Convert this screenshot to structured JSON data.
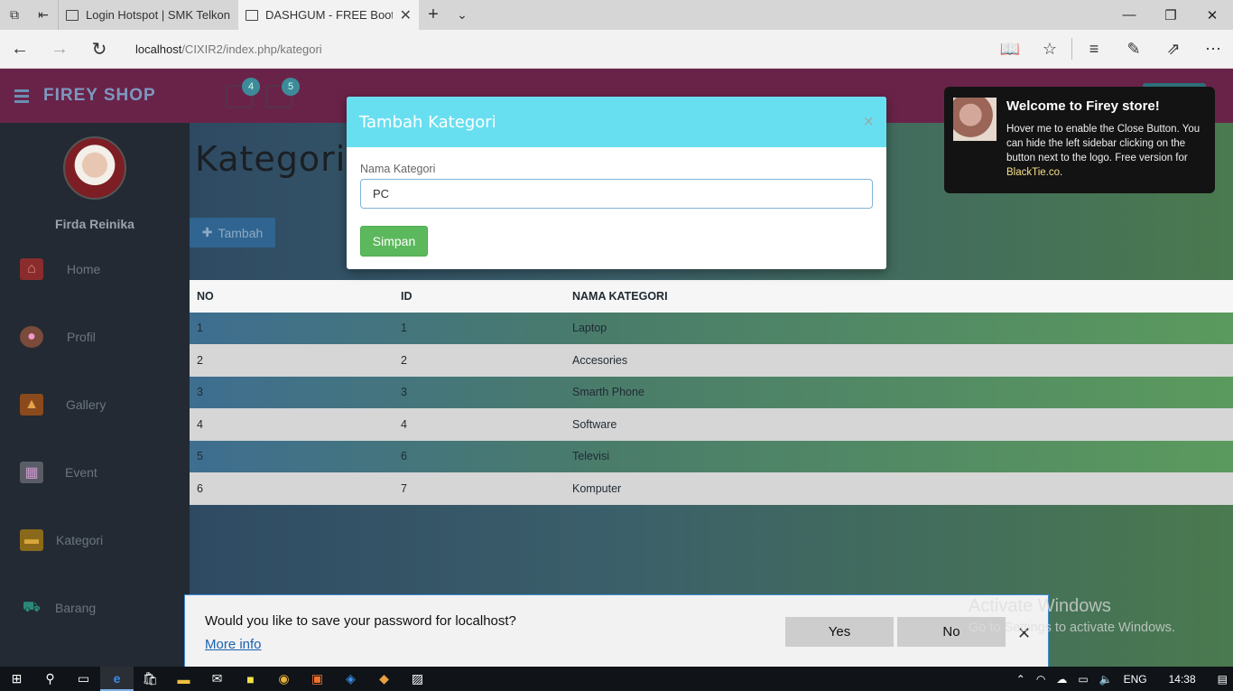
{
  "browser": {
    "tabs": [
      {
        "title": "Login Hotspot | SMK Telkon",
        "active": false
      },
      {
        "title": "DASHGUM - FREE Boots",
        "active": true
      }
    ],
    "url_host": "localhost",
    "url_path": "/CIXIR2/index.php/kategori"
  },
  "header": {
    "logo": "FIREY SHOP",
    "badges": [
      "4",
      "5"
    ]
  },
  "sidebar": {
    "username": "Firda Reinika",
    "items": [
      {
        "label": "Home",
        "icon": "home-icon"
      },
      {
        "label": "Profil",
        "icon": "user-icon"
      },
      {
        "label": "Gallery",
        "icon": "image-icon"
      },
      {
        "label": "Event",
        "icon": "calendar-icon"
      },
      {
        "label": "Kategori",
        "icon": "folder-icon"
      },
      {
        "label": "Barang",
        "icon": "cart-icon"
      }
    ]
  },
  "main": {
    "title": "Kategori",
    "add_button": "Tambah",
    "table": {
      "headers": [
        "NO",
        "ID",
        "NAMA KATEGORI"
      ],
      "rows": [
        [
          "1",
          "1",
          "Laptop"
        ],
        [
          "2",
          "2",
          "Accesories"
        ],
        [
          "3",
          "3",
          "Smarth Phone"
        ],
        [
          "4",
          "4",
          "Software"
        ],
        [
          "5",
          "6",
          "Televisi"
        ],
        [
          "6",
          "7",
          "Komputer"
        ]
      ]
    }
  },
  "modal": {
    "title": "Tambah Kategori",
    "label": "Nama Kategori",
    "input_value": "PC",
    "save_button": "Simpan"
  },
  "toast": {
    "title": "Welcome to Firey store!",
    "body": "Hover me to enable the Close Button. You can hide the left sidebar clicking on the button next to the logo. Free version for ",
    "link": "BlackTie.co",
    "end": "."
  },
  "password_prompt": {
    "question": "Would you like to save your password for localhost?",
    "more_info": "More info",
    "yes": "Yes",
    "no": "No"
  },
  "watermark": {
    "line1": "Activate Windows",
    "line2": "Go to Settings to activate Windows."
  },
  "taskbar": {
    "language": "ENG",
    "time": "14:38"
  }
}
